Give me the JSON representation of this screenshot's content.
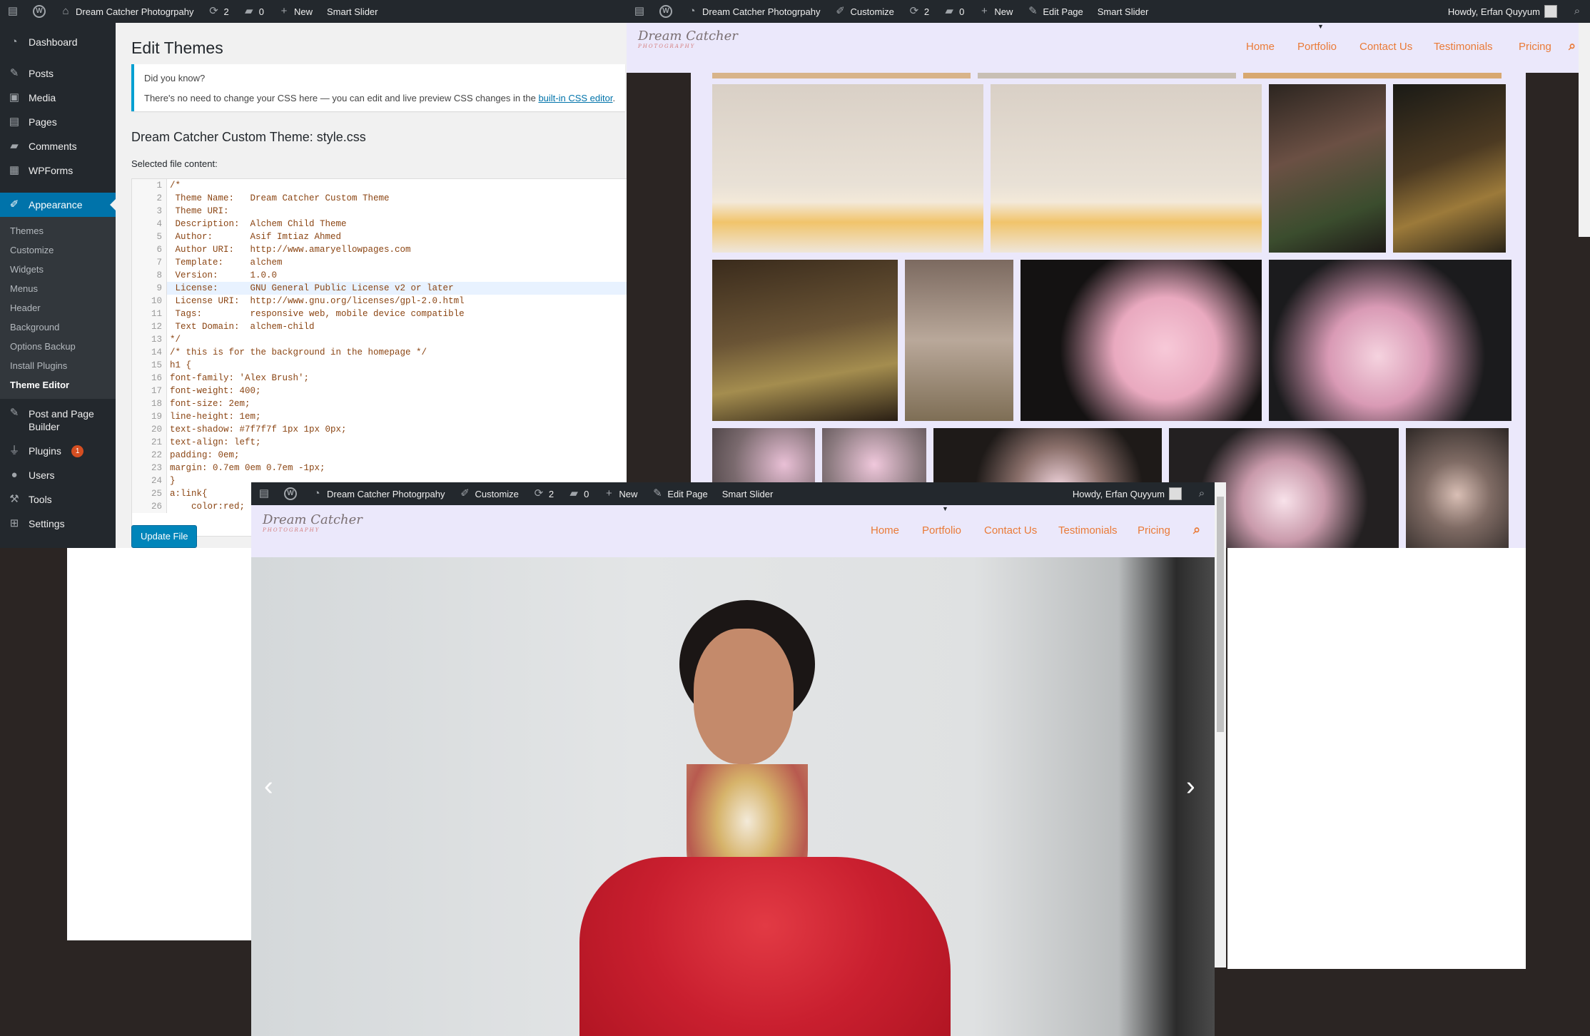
{
  "admin_bar_main": {
    "site_name": "Dream Catcher Photogrpahy",
    "updates": "2",
    "comments": "0",
    "new": "New",
    "smart_slider": "Smart Slider"
  },
  "admin_bar_site": {
    "site_name": "Dream Catcher Photogrpahy",
    "customize": "Customize",
    "updates": "2",
    "comments": "0",
    "new": "New",
    "edit_page": "Edit Page",
    "smart_slider": "Smart Slider",
    "howdy": "Howdy, Erfan Quyyum"
  },
  "sidebar": {
    "items": [
      {
        "label": "Dashboard",
        "icon": "dashboard-icon"
      },
      {
        "label": "Posts",
        "icon": "pin-icon"
      },
      {
        "label": "Media",
        "icon": "media-icon"
      },
      {
        "label": "Pages",
        "icon": "pages-icon"
      },
      {
        "label": "Comments",
        "icon": "comments-icon"
      },
      {
        "label": "WPForms",
        "icon": "forms-icon"
      },
      {
        "label": "Appearance",
        "icon": "brush-icon"
      }
    ],
    "appearance_sub": [
      "Themes",
      "Customize",
      "Widgets",
      "Menus",
      "Header",
      "Background",
      "Options Backup",
      "Install Plugins",
      "Theme Editor"
    ],
    "bottom_items": [
      {
        "label": "Post and Page Builder",
        "icon": "builder-icon"
      },
      {
        "label": "Plugins",
        "icon": "plugin-icon",
        "badge": "1"
      },
      {
        "label": "Users",
        "icon": "users-icon"
      },
      {
        "label": "Tools",
        "icon": "tools-icon"
      },
      {
        "label": "Settings",
        "icon": "settings-icon"
      }
    ]
  },
  "editor": {
    "title": "Edit Themes",
    "notice_title": "Did you know?",
    "notice_text": "There's no need to change your CSS here — you can edit and live preview CSS changes in the",
    "notice_link": "built-in CSS editor",
    "notice_end": ".",
    "file_heading": "Dream Catcher Custom Theme: style.css",
    "selected_label": "Selected file content:",
    "update_button": "Update File",
    "lines": [
      "/*",
      " Theme Name:   Dream Catcher Custom Theme",
      " Theme URI:",
      " Description:  Alchem Child Theme",
      " Author:       Asif Imtiaz Ahmed",
      " Author URI:   http://www.amaryellowpages.com",
      " Template:     alchem",
      " Version:      1.0.0",
      " License:      GNU General Public License v2 or later",
      " License URI:  http://www.gnu.org/licenses/gpl-2.0.html",
      " Tags:         responsive web, mobile device compatible",
      " Text Domain:  alchem-child",
      "*/",
      "/* this is for the background in the homepage */",
      "h1 {",
      "font-family: 'Alex Brush';",
      "font-weight: 400;",
      "font-size: 2em;",
      "line-height: 1em;",
      "text-shadow: #7f7f7f 1px 1px 0px;",
      "text-align: left;",
      "padding: 0em;",
      "margin: 0.7em 0em 0.7em -1px;",
      "}",
      "a:link{",
      "    color:red;"
    ]
  },
  "site": {
    "logo_text": "Dream Catcher",
    "logo_sub": "PHOTOGRAPHY",
    "nav": [
      "Home",
      "Portfolio",
      "Contact Us",
      "Testimonials",
      "Pricing"
    ]
  },
  "colors": {
    "admin_bar": "#23282d",
    "wp_blue": "#0073aa",
    "nav_orange": "#ea7b38",
    "header_lavender": "#ebe8fb"
  }
}
